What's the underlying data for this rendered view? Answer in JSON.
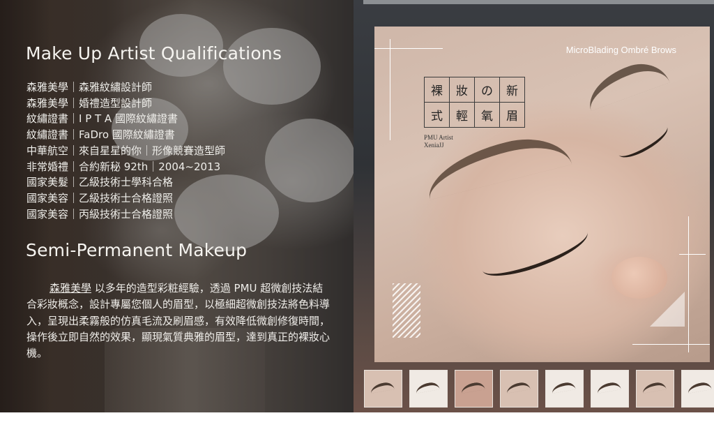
{
  "qualifications": {
    "heading": "Make Up Artist Qualifications",
    "items": [
      "森雅美學｜森雅紋繡設計師",
      "森雅美學｜婚禮造型設計師",
      "紋繡證書｜I P T A 國際紋繡證書",
      "紋繡證書｜FaDro 國際紋繡證書",
      "中華航空｜來自星星的你｜形像競賽造型師",
      "非常婚禮｜合約新秘 92th｜2004~2013",
      "國家美髮｜乙級技術士學科合格",
      "國家美容｜乙級技術士合格證照",
      "國家美容｜丙級技術士合格證照"
    ]
  },
  "pmu": {
    "heading": "Semi-Permanent Makeup",
    "brand": "森雅美學",
    "body": " 以多年的造型彩粧經驗，透過 PMU 超微創技法結合彩妝概念，設計專屬您個人的眉型，以極細超微創技法將色料導入，呈現出柔霧般的仿真毛流及刷眉感，有效降低微創修復時間，操作後立即自然的效果，顯現氣質典雅的眉型，達到真正的裸妝心機。"
  },
  "gallery": {
    "main_caption": "MicroBlading Ombré Brows",
    "title_chars": [
      "裸",
      "妝",
      "の",
      "新",
      "式",
      "輕",
      "氧",
      "眉"
    ],
    "artist_line1": "PMU Artist",
    "artist_line2": "XeniaJJ",
    "thumbnail_count": 8
  }
}
